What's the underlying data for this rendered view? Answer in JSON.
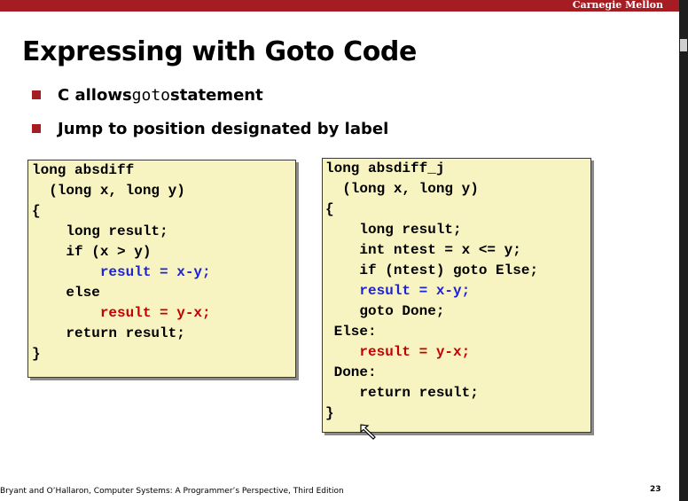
{
  "header": {
    "brand": "Carnegie Mellon"
  },
  "slide": {
    "title": "Expressing with Goto Code",
    "bullets": [
      {
        "pre": "C allows ",
        "code": "goto",
        "post": " statement"
      },
      {
        "pre": "Jump to position designated by label",
        "code": "",
        "post": ""
      }
    ]
  },
  "code_left": {
    "lines": [
      {
        "text": "long absdiff",
        "color": "#000000"
      },
      {
        "text": "  (long x, long y)",
        "color": "#000000"
      },
      {
        "text": "{",
        "color": "#000000"
      },
      {
        "text": "    long result;",
        "color": "#000000"
      },
      {
        "text": "    if (x > y)",
        "color": "#000000"
      },
      {
        "text": "        result = x-y;",
        "color": "#1e22d6"
      },
      {
        "text": "    else",
        "color": "#000000"
      },
      {
        "text": "        result = y-x;",
        "color": "#c60000"
      },
      {
        "text": "    return result;",
        "color": "#000000"
      },
      {
        "text": "}",
        "color": "#000000"
      }
    ]
  },
  "code_right": {
    "lines": [
      {
        "text": "long absdiff_j",
        "color": "#000000"
      },
      {
        "text": "  (long x, long y)",
        "color": "#000000"
      },
      {
        "text": "{",
        "color": "#000000"
      },
      {
        "text": "    long result;",
        "color": "#000000"
      },
      {
        "text": "    int ntest = x <= y;",
        "color": "#000000"
      },
      {
        "text": "    if (ntest) goto Else;",
        "color": "#000000"
      },
      {
        "text": "    result = x-y;",
        "color": "#1e22d6"
      },
      {
        "text": "    goto Done;",
        "color": "#000000"
      },
      {
        "text": " Else:",
        "color": "#000000"
      },
      {
        "text": "    result = y-x;",
        "color": "#c60000"
      },
      {
        "text": " Done:",
        "color": "#000000"
      },
      {
        "text": "    return result;",
        "color": "#000000"
      },
      {
        "text": "}",
        "color": "#000000"
      }
    ]
  },
  "footer": {
    "citation": "Bryant and O’Hallaron, Computer Systems: A Programmer’s Perspective, Third Edition",
    "page": "23"
  },
  "colors": {
    "accent": "#a51d23",
    "code_bg": "#f7f4c1"
  }
}
